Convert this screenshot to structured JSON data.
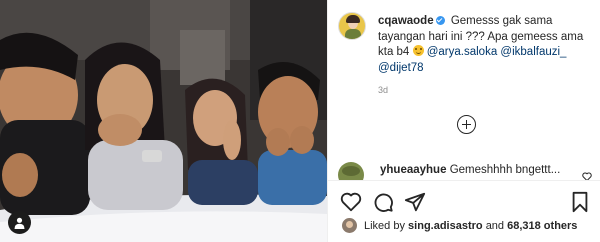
{
  "post": {
    "photo_alt": "",
    "tag_icon": "user-tag-icon"
  },
  "caption": {
    "username": "cqawaode",
    "text_1": "Gemesss gak sama tayangan hari ini ??? Apa gemeess ama kta b4",
    "mentions": [
      "@arya.saloka",
      "@ikbalfauzi_",
      "@dijet78"
    ],
    "time_ago": "3d"
  },
  "comment": {
    "username": "yhueaayhue",
    "text": "Gemeshhhh bngettt..."
  },
  "actions": {
    "like_icon": "heart-icon",
    "comment_icon": "comment-icon",
    "share_icon": "share-icon",
    "save_icon": "bookmark-icon"
  },
  "likes": {
    "prefix": "Liked by",
    "user": "sing.adisastro",
    "connector": "and",
    "count_text": "68,318 others"
  },
  "colors": {
    "verified": "#3897f0",
    "mention": "#00376b",
    "muted": "#8e8e8e"
  }
}
